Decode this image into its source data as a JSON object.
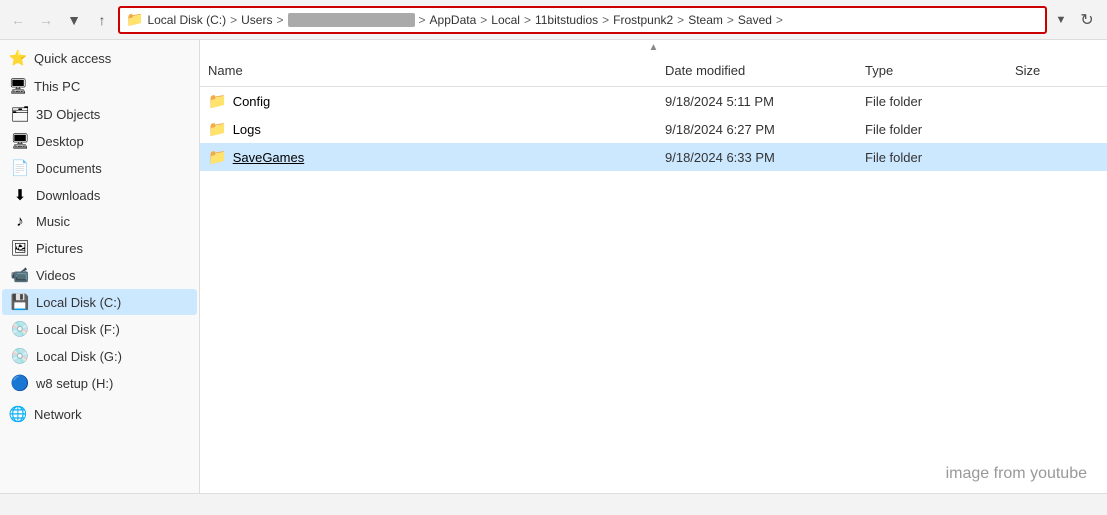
{
  "toolbar": {
    "back_btn": "←",
    "forward_btn": "→",
    "recent_btn": "▾",
    "up_btn": "↑",
    "chevron_down": "▾",
    "refresh": "↻",
    "path": {
      "icon": "📁",
      "segments": [
        {
          "label": "Local Disk (C:)",
          "blurred": false
        },
        {
          "label": "Users",
          "blurred": false
        },
        {
          "label": "██████████████",
          "blurred": true
        },
        {
          "label": "AppData",
          "blurred": false
        },
        {
          "label": "Local",
          "blurred": false
        },
        {
          "label": "11bitstudios",
          "blurred": false
        },
        {
          "label": "Frostpunk2",
          "blurred": false
        },
        {
          "label": "Steam",
          "blurred": false
        },
        {
          "label": "Saved",
          "blurred": false
        }
      ]
    }
  },
  "sidebar": {
    "quick_access_label": "Quick access",
    "this_pc_label": "This PC",
    "items": [
      {
        "id": "3d-objects",
        "label": "3D Objects",
        "icon": "🗂"
      },
      {
        "id": "desktop",
        "label": "Desktop",
        "icon": "🖥"
      },
      {
        "id": "documents",
        "label": "Documents",
        "icon": "📄"
      },
      {
        "id": "downloads",
        "label": "Downloads",
        "icon": "⬇"
      },
      {
        "id": "music",
        "label": "Music",
        "icon": "♪"
      },
      {
        "id": "pictures",
        "label": "Pictures",
        "icon": "🖼"
      },
      {
        "id": "videos",
        "label": "Videos",
        "icon": "📹"
      },
      {
        "id": "local-disk-c",
        "label": "Local Disk (C:)",
        "icon": "💾",
        "active": true
      },
      {
        "id": "local-disk-f",
        "label": "Local Disk (F:)",
        "icon": "💿"
      },
      {
        "id": "local-disk-g",
        "label": "Local Disk (G:)",
        "icon": "💿"
      },
      {
        "id": "w8-setup",
        "label": "w8 setup (H:)",
        "icon": "🔵"
      }
    ],
    "network_label": "Network",
    "network_icon": "🌐"
  },
  "columns": {
    "name": "Name",
    "date_modified": "Date modified",
    "type": "Type",
    "size": "Size"
  },
  "files": [
    {
      "name": "Config",
      "date_modified": "9/18/2024 5:11 PM",
      "type": "File folder",
      "size": "",
      "icon_color": "yellow",
      "selected": false
    },
    {
      "name": "Logs",
      "date_modified": "9/18/2024 6:27 PM",
      "type": "File folder",
      "size": "",
      "icon_color": "yellow",
      "selected": false
    },
    {
      "name": "SaveGames",
      "date_modified": "9/18/2024 6:33 PM",
      "type": "File folder",
      "size": "",
      "icon_color": "blue",
      "selected": true
    }
  ],
  "watermark": "image from youtube",
  "status": ""
}
